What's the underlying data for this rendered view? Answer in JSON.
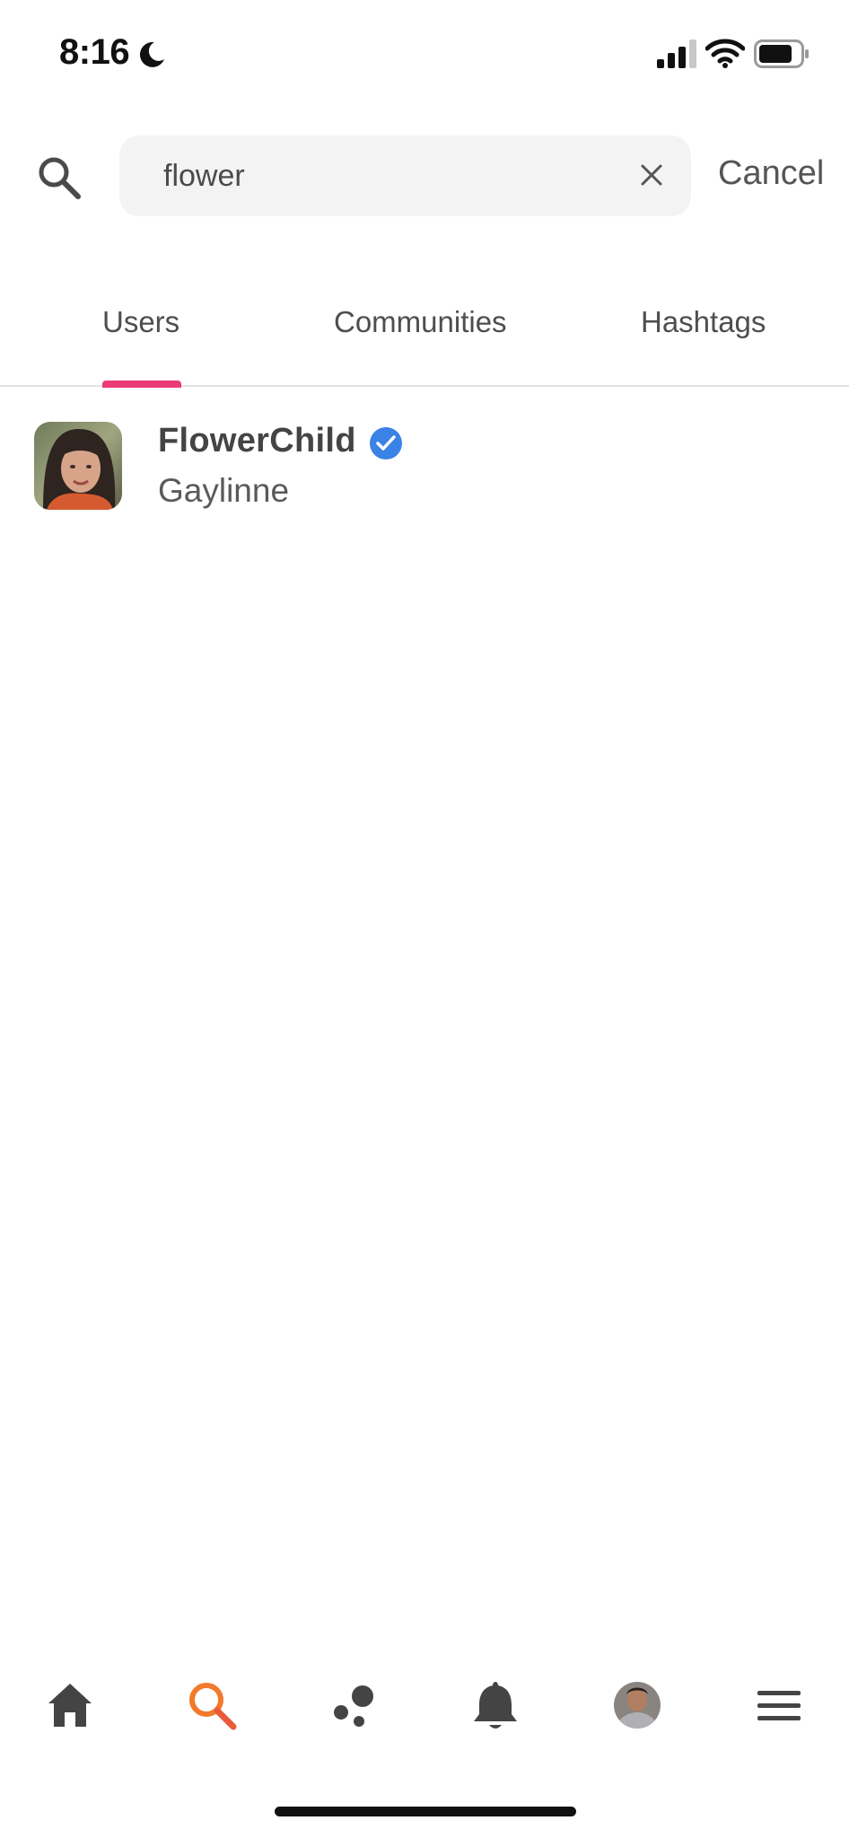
{
  "status_bar": {
    "time": "8:16"
  },
  "search": {
    "value": "flower",
    "cancel_label": "Cancel"
  },
  "tabs": [
    {
      "label": "Users",
      "active": true
    },
    {
      "label": "Communities",
      "active": false
    },
    {
      "label": "Hashtags",
      "active": false
    }
  ],
  "results": [
    {
      "name": "FlowerChild",
      "verified": true,
      "subtitle": "Gaylinne"
    }
  ],
  "bottom_nav": [
    {
      "icon": "home-icon"
    },
    {
      "icon": "search-icon",
      "active": true
    },
    {
      "icon": "discover-icon"
    },
    {
      "icon": "bell-icon"
    },
    {
      "icon": "profile-avatar"
    },
    {
      "icon": "menu-icon"
    }
  ],
  "colors": {
    "accent_tab": "#ea3a78",
    "active_nav": "#f27a2b",
    "verified_badge": "#3b82e6",
    "icon_gray": "#444444"
  }
}
